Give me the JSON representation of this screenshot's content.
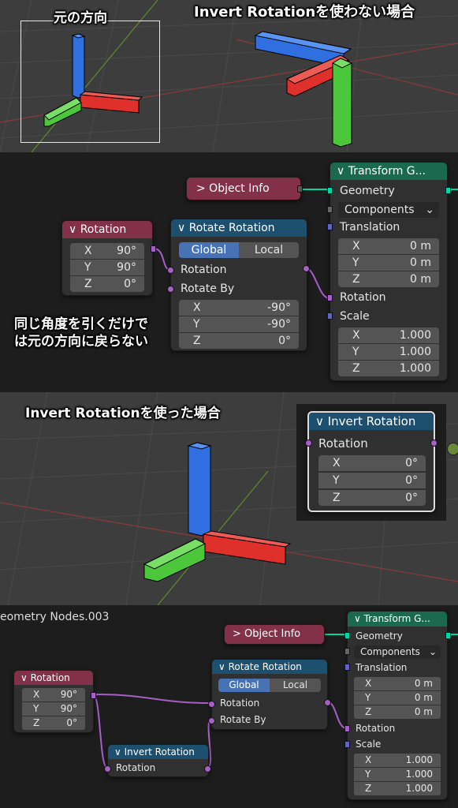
{
  "top": {
    "caption_original": "元の方向",
    "caption_without": "Invert Rotationを使わない場合",
    "caption_subtract": [
      "同じ角度を引くだけで",
      "は元の方向に戻らない"
    ]
  },
  "editor1": {
    "object_info": "> Object Info",
    "transform": {
      "title": "∨ Transform G...",
      "geometry": "Geometry",
      "components": "Components",
      "translation": "Translation",
      "t": [
        [
          "X",
          "0 m"
        ],
        [
          "Y",
          "0 m"
        ],
        [
          "Z",
          "0 m"
        ]
      ],
      "rotation": "Rotation",
      "scale": "Scale",
      "s": [
        [
          "X",
          "1.000"
        ],
        [
          "Y",
          "1.000"
        ],
        [
          "Z",
          "1.000"
        ]
      ]
    },
    "rotation_node": {
      "title": "∨ Rotation",
      "v": [
        [
          "X",
          "90°"
        ],
        [
          "Y",
          "90°"
        ],
        [
          "Z",
          "0°"
        ]
      ]
    },
    "rotate_rotation": {
      "title": "∨ Rotate Rotation",
      "global": "Global",
      "local": "Local",
      "rotation": "Rotation",
      "rotate_by": "Rotate By",
      "v": [
        [
          "X",
          "-90°"
        ],
        [
          "Y",
          "-90°"
        ],
        [
          "Z",
          "0°"
        ]
      ]
    }
  },
  "middle": {
    "caption_with": "Invert Rotationを使った場合",
    "invert": {
      "title": "∨ Invert Rotation",
      "rotation": "Rotation",
      "v": [
        [
          "X",
          "0°"
        ],
        [
          "Y",
          "0°"
        ],
        [
          "Z",
          "0°"
        ]
      ]
    }
  },
  "editor2": {
    "tree_name": "eometry Nodes.003",
    "object_info": "> Object Info",
    "transform": {
      "title": "∨ Transform G...",
      "geometry": "Geometry",
      "components": "Components",
      "translation": "Translation",
      "t": [
        [
          "X",
          "0 m"
        ],
        [
          "Y",
          "0 m"
        ],
        [
          "Z",
          "0 m"
        ]
      ],
      "rotation": "Rotation",
      "scale": "Scale",
      "s": [
        [
          "X",
          "1.000"
        ],
        [
          "Y",
          "1.000"
        ],
        [
          "Z",
          "1.000"
        ]
      ]
    },
    "rotation_node": {
      "title": "∨ Rotation",
      "v": [
        [
          "X",
          "90°"
        ],
        [
          "Y",
          "90°"
        ],
        [
          "Z",
          "0°"
        ]
      ]
    },
    "rotate_rotation": {
      "title": "∨ Rotate Rotation",
      "global": "Global",
      "local": "Local",
      "rotation": "Rotation",
      "rotate_by": "Rotate By"
    },
    "invert": {
      "title": "∨ Invert Rotation",
      "rotation": "Rotation"
    }
  },
  "colors": {
    "x_axis": "#e0302c",
    "y_axis": "#4cc73c",
    "z_axis": "#2f6fe0",
    "rotation_socket": "#a55fc7",
    "geometry_socket": "#00d6a3"
  }
}
